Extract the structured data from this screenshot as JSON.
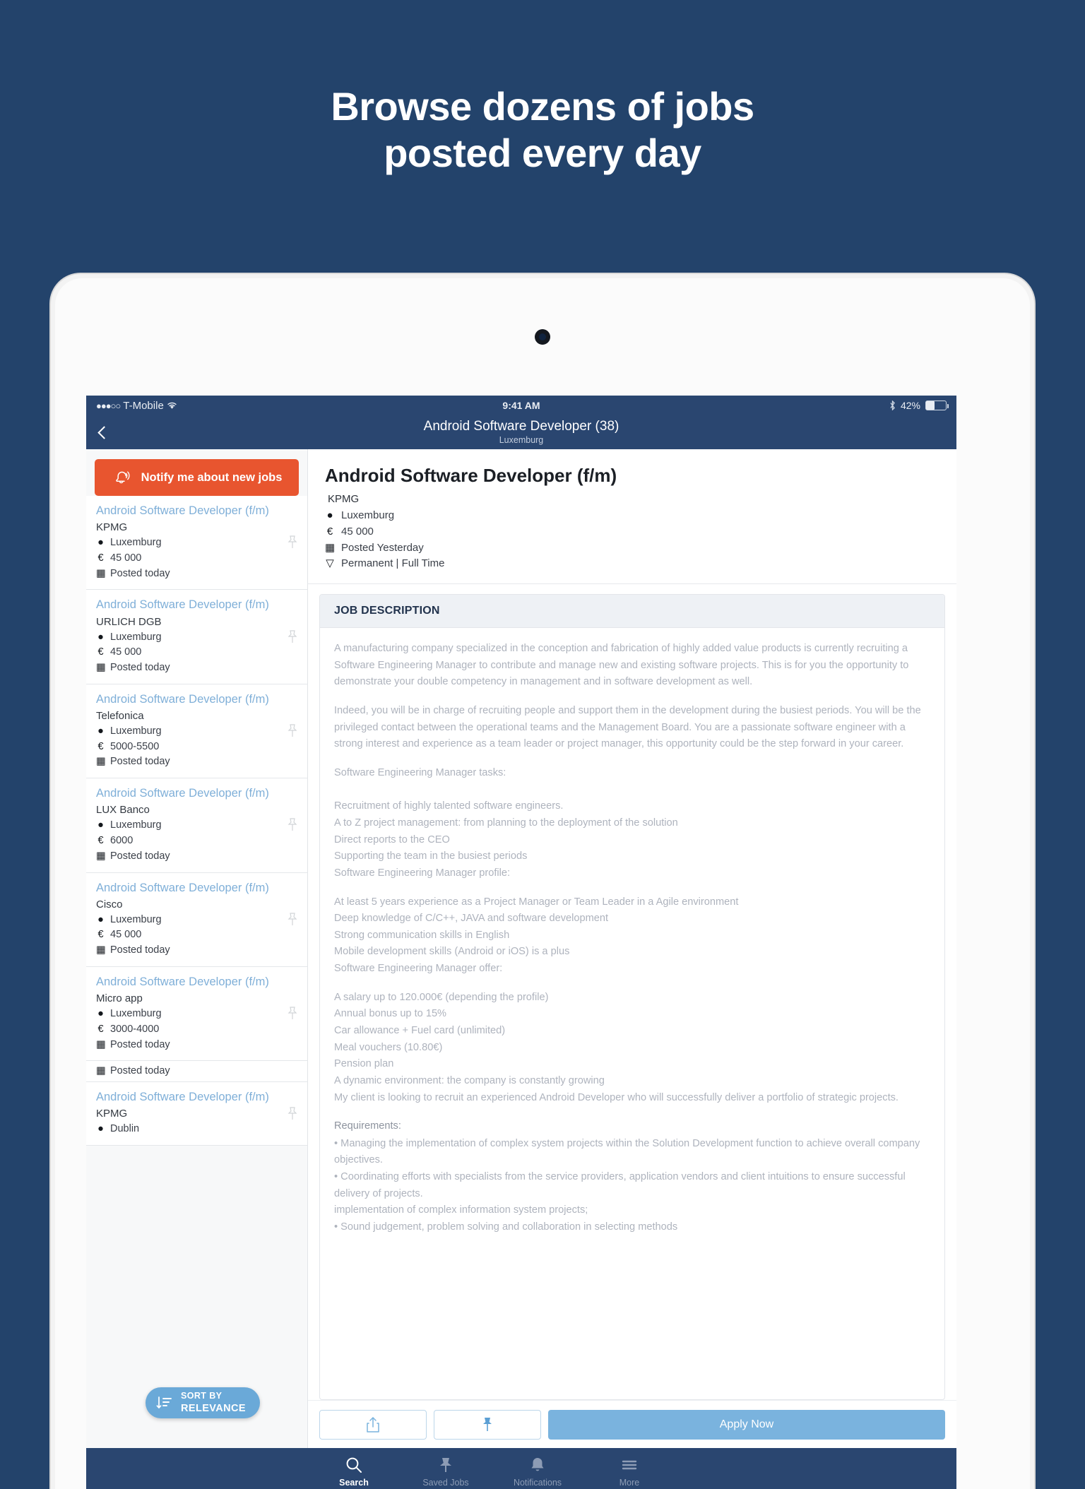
{
  "promo": {
    "line1": "Browse dozens of jobs",
    "line2": "posted every day"
  },
  "status_bar": {
    "signal_dots": "●●●○○",
    "carrier": "T-Mobile",
    "wifi_icon": "wifi-icon",
    "time": "9:41 AM",
    "bluetooth_icon": "bluetooth-icon",
    "battery_percent": "42%",
    "battery_icon": "battery-icon"
  },
  "nav": {
    "back_icon": "chevron-left-icon",
    "title": "Android Software Developer (38)",
    "subtitle": "Luxemburg"
  },
  "list_pane": {
    "notify_button": {
      "label": "Notify me about new jobs",
      "icon": "bell-icon",
      "color": "#e8552f"
    },
    "jobs": [
      {
        "title": "Android Software Developer (f/m)",
        "company": "KPMG",
        "location": "Luxemburg",
        "salary": "45 000",
        "posted": "Posted today"
      },
      {
        "title": "Android Software Developer (f/m)",
        "company": "URLICH DGB",
        "location": "Luxemburg",
        "salary": "45 000",
        "posted": "Posted today"
      },
      {
        "title": "Android Software Developer (f/m)",
        "company": "Telefonica",
        "location": "Luxemburg",
        "salary": "5000-5500",
        "posted": "Posted today"
      },
      {
        "title": "Android Software Developer (f/m)",
        "company": "LUX Banco",
        "location": "Luxemburg",
        "salary": "6000",
        "posted": "Posted today"
      },
      {
        "title": "Android Software Developer (f/m)",
        "company": "Cisco",
        "location": "Luxemburg",
        "salary": "45 000",
        "posted": "Posted today"
      },
      {
        "title": "Android Software Developer (f/m)",
        "company": "Micro app",
        "location": "Luxemburg",
        "salary": "3000-4000",
        "posted": "Posted today"
      }
    ],
    "partial_row_text": "Posted today",
    "last_job": {
      "title": "Android Software Developer (f/m)",
      "company": "KPMG",
      "location": "Dublin"
    },
    "sort_pill": {
      "icon": "sort-icon",
      "label_small": "SORT BY",
      "label_big": "RELEVANCE",
      "color": "#6aa9d8"
    }
  },
  "detail": {
    "title": "Android Software Developer (f/m)",
    "company": "KPMG",
    "location": "Luxemburg",
    "salary": "45 000",
    "posted": "Posted Yesterday",
    "contract": "Permanent | Full Time",
    "section_header": "JOB DESCRIPTION",
    "paragraphs": [
      "A manufacturing company specialized in the conception and fabrication of highly added value products is currently recruiting a Software Engineering Manager to contribute and manage new and existing software projects. This is for you the opportunity to demonstrate your double competency in management and in software development as well.",
      "Indeed, you will be in charge of recruiting people and support them in the development during the busiest periods. You will be the privileged contact between the operational teams and the Management Board. You are a passionate software engineer with a strong interest and experience as a team leader or project manager, this opportunity could be the step forward in your career."
    ],
    "tasks_heading": "Software Engineering Manager tasks:",
    "tasks": [
      "Recruitment of highly talented software engineers.",
      "A to Z project management: from planning to the deployment of the solution",
      "Direct reports to the CEO",
      "Supporting the team in the busiest periods",
      "Software Engineering Manager profile:"
    ],
    "profile": [
      "At least 5 years experience as a Project Manager or Team Leader in a Agile environment",
      "Deep knowledge of C/C++, JAVA and software development",
      "Strong communication skills in English",
      "Mobile development skills (Android or iOS) is a plus",
      "Software Engineering Manager offer:"
    ],
    "offer": [
      "A salary up to 120.000€ (depending the profile)",
      "Annual bonus up to 15%",
      "Car allowance + Fuel card (unlimited)",
      "Meal vouchers (10.80€)",
      "Pension plan",
      "A dynamic environment: the company is constantly growing",
      "My client is looking to recruit an experienced Android Developer  who will successfully deliver a portfolio of strategic projects."
    ],
    "requirements_heading": "Requirements:",
    "requirements": [
      "• Managing the implementation of complex system projects within the Solution Development function to achieve overall company objectives.",
      "• Coordinating efforts with specialists from the service providers, application vendors and client intuitions to ensure successful delivery of projects.",
      "implementation of complex information system projects;",
      "• Sound judgement, problem solving and collaboration in selecting methods"
    ]
  },
  "action_bar": {
    "share_icon": "share-icon",
    "pin_icon": "pin-icon",
    "apply_label": "Apply Now",
    "apply_color": "#7ab3de"
  },
  "tab_bar": {
    "tabs": [
      {
        "label": "Search",
        "icon": "search-icon",
        "active": true
      },
      {
        "label": "Saved Jobs",
        "icon": "pin-icon",
        "active": false
      },
      {
        "label": "Notifications",
        "icon": "bell-icon",
        "active": false
      },
      {
        "label": "More",
        "icon": "hamburger-icon",
        "active": false
      }
    ]
  }
}
